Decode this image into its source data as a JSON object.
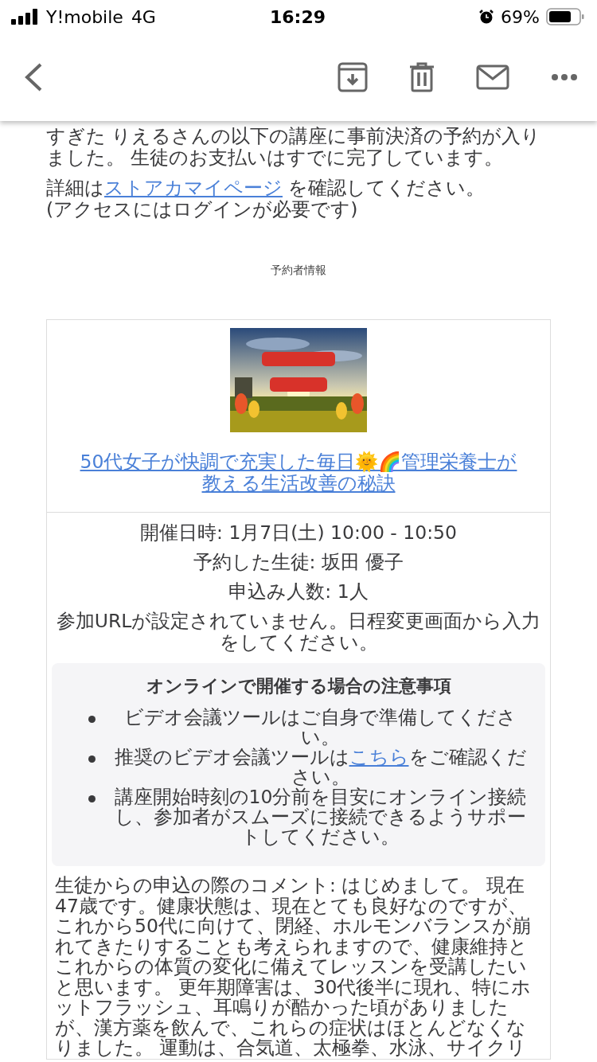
{
  "status_bar": {
    "carrier": "Y!mobile",
    "network": "4G",
    "time": "16:29",
    "battery": "69%"
  },
  "intro": "すぎた りえるさんの以下の講座に事前決済の予約が入りました。 生徒のお支払いはすでに完了しています。",
  "details": {
    "before": "詳細は",
    "link": "ストアカマイページ",
    "after": " を確認してください。"
  },
  "login_note": "(アクセスにはログインが必要です)",
  "section_label": "予約者情報",
  "course": {
    "title": "50代女子が快調で充実した毎日🌞🌈管理栄養士が教える生活改善の秘訣"
  },
  "booking": [
    "開催日時: 1月7日(土) 10:00 - 10:50",
    "予約した生徒: 坂田 優子",
    "申込み人数: 1人",
    "参加URLが設定されていません。日程変更画面から入力をしてください。"
  ],
  "online_notice": {
    "title": "オンラインで開催する場合の注意事項",
    "items": [
      {
        "before": "ビデオ会議ツールはご自身で準備してください。"
      },
      {
        "before": "推奨のビデオ会議ツールは",
        "link": "こちら",
        "after": "をご確認ください。"
      },
      {
        "before": "講座開始時刻の10分前を目安にオンライン接続し、参加者がスムーズに接続できるようサポートしてください。"
      }
    ]
  },
  "comment": "生徒からの申込の際のコメント: はじめまして。 現在47歳です。健康状態は、現在とても良好なのですが、これから50代に向けて、閉経、ホルモンバランスが崩れてきたりすることも考えられますので、健康維持とこれからの体質の変化に備えてレッスンを受講したいと思います。 更年期障害は、30代後半に現れ、特にホットフラッシュ、耳鳴りが酷かった頃がありましたが、漢方薬を飲んで、これらの症状はほとんどなくなりました。 運動は、合気道、太極拳、水泳、サイクリ"
}
